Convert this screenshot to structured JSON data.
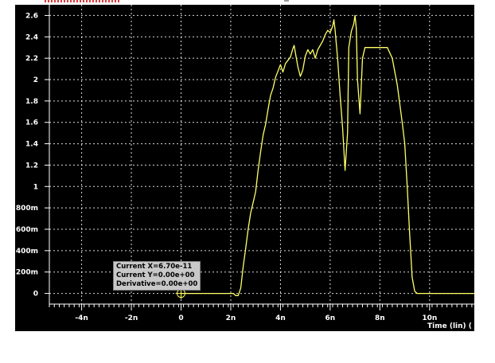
{
  "chart_data": {
    "type": "line",
    "title": "",
    "xlabel": "Time (lin) (",
    "ylabel": "",
    "x_unit": "s",
    "xlim": [
      -5.3e-09,
      1.18e-08
    ],
    "ylim": [
      -0.1,
      2.7
    ],
    "grid": true,
    "x_ticks": [
      {
        "value": -4e-09,
        "label": "-4n"
      },
      {
        "value": -2e-09,
        "label": "-2n"
      },
      {
        "value": 0,
        "label": "0"
      },
      {
        "value": 2e-09,
        "label": "2n"
      },
      {
        "value": 4e-09,
        "label": "4n"
      },
      {
        "value": 6e-09,
        "label": "6n"
      },
      {
        "value": 8e-09,
        "label": "8n"
      },
      {
        "value": 1e-08,
        "label": "10n"
      }
    ],
    "y_ticks": [
      {
        "value": 0,
        "label": "0"
      },
      {
        "value": 0.2,
        "label": "200m"
      },
      {
        "value": 0.4,
        "label": "400m"
      },
      {
        "value": 0.6,
        "label": "600m"
      },
      {
        "value": 0.8,
        "label": "800m"
      },
      {
        "value": 1.0,
        "label": "1"
      },
      {
        "value": 1.2,
        "label": "1.2"
      },
      {
        "value": 1.4,
        "label": "1.4"
      },
      {
        "value": 1.6,
        "label": "1.6"
      },
      {
        "value": 1.8,
        "label": "1.8"
      },
      {
        "value": 2.0,
        "label": "2"
      },
      {
        "value": 2.2,
        "label": "2.2"
      },
      {
        "value": 2.4,
        "label": "2.4"
      },
      {
        "value": 2.6,
        "label": "2.6"
      }
    ],
    "series": [
      {
        "color": "#ffff66",
        "points": [
          [
            0,
            0
          ],
          [
            2.1e-09,
            0
          ],
          [
            2.2e-09,
            -0.02
          ],
          [
            2.3e-09,
            -0.02
          ],
          [
            2.4e-09,
            0.05
          ],
          [
            2.5e-09,
            0.25
          ],
          [
            2.6e-09,
            0.42
          ],
          [
            2.7e-09,
            0.6
          ],
          [
            2.8e-09,
            0.75
          ],
          [
            2.9e-09,
            0.85
          ],
          [
            3e-09,
            0.95
          ],
          [
            3.1e-09,
            1.15
          ],
          [
            3.2e-09,
            1.32
          ],
          [
            3.3e-09,
            1.48
          ],
          [
            3.4e-09,
            1.58
          ],
          [
            3.5e-09,
            1.72
          ],
          [
            3.6e-09,
            1.85
          ],
          [
            3.7e-09,
            1.92
          ],
          [
            3.8e-09,
            2.02
          ],
          [
            3.9e-09,
            2.08
          ],
          [
            4e-09,
            2.14
          ],
          [
            4.1e-09,
            2.07
          ],
          [
            4.2e-09,
            2.15
          ],
          [
            4.3e-09,
            2.18
          ],
          [
            4.4e-09,
            2.21
          ],
          [
            4.5e-09,
            2.29
          ],
          [
            4.55e-09,
            2.32
          ],
          [
            4.6e-09,
            2.25
          ],
          [
            4.7e-09,
            2.12
          ],
          [
            4.8e-09,
            2.03
          ],
          [
            4.9e-09,
            2.09
          ],
          [
            5e-09,
            2.22
          ],
          [
            5.1e-09,
            2.28
          ],
          [
            5.2e-09,
            2.24
          ],
          [
            5.3e-09,
            2.28
          ],
          [
            5.4e-09,
            2.2
          ],
          [
            5.5e-09,
            2.28
          ],
          [
            5.6e-09,
            2.32
          ],
          [
            5.7e-09,
            2.36
          ],
          [
            5.8e-09,
            2.42
          ],
          [
            5.9e-09,
            2.46
          ],
          [
            6e-09,
            2.44
          ],
          [
            6.1e-09,
            2.5
          ],
          [
            6.15e-09,
            2.56
          ],
          [
            6.2e-09,
            2.46
          ],
          [
            6.3e-09,
            2.2
          ],
          [
            6.4e-09,
            1.85
          ],
          [
            6.5e-09,
            1.55
          ],
          [
            6.6e-09,
            1.15
          ],
          [
            6.7e-09,
            1.5
          ],
          [
            6.75e-09,
            2.3
          ],
          [
            6.85e-09,
            2.45
          ],
          [
            6.95e-09,
            2.52
          ],
          [
            7e-09,
            2.6
          ],
          [
            7.05e-09,
            2.48
          ],
          [
            7.1e-09,
            2.0
          ],
          [
            7.2e-09,
            1.68
          ],
          [
            7.3e-09,
            2.2
          ],
          [
            7.4e-09,
            2.3
          ],
          [
            8.3e-09,
            2.3
          ],
          [
            8.5e-09,
            2.2
          ],
          [
            8.7e-09,
            1.95
          ],
          [
            8.9e-09,
            1.6
          ],
          [
            9e-09,
            1.4
          ],
          [
            9.1e-09,
            1.0
          ],
          [
            9.2e-09,
            0.55
          ],
          [
            9.3e-09,
            0.15
          ],
          [
            9.4e-09,
            0.02
          ],
          [
            9.5e-09,
            0
          ],
          [
            1.18e-08,
            0
          ]
        ]
      }
    ],
    "cursor": {
      "x": 0,
      "y": 0
    }
  },
  "readout": {
    "current_x": "Current X=6.70e-11",
    "current_y": "Current Y=0.00e+00",
    "derivative": "Derivative=0.00e+00"
  }
}
